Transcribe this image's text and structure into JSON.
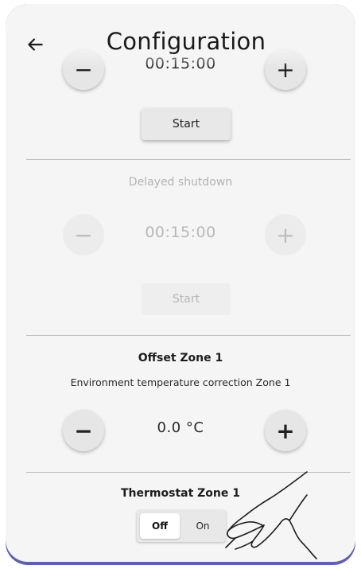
{
  "header": {
    "title": "Configuration",
    "back_icon": "arrow-left-icon"
  },
  "timer_section": {
    "time_value": "00:15:00",
    "minus_icon": "minus-icon",
    "plus_icon": "plus-icon",
    "start_label": "Start"
  },
  "delayed_shutdown": {
    "title": "Delayed shutdown",
    "time_value": "00:15:00",
    "minus_icon": "minus-icon",
    "plus_icon": "plus-icon",
    "start_label": "Start",
    "disabled": true
  },
  "offset_zone": {
    "title": "Offset Zone 1",
    "subtitle": "Environment temperature correction Zone 1",
    "value": "0.0 °C",
    "minus_icon": "minus-icon",
    "plus_icon": "plus-icon"
  },
  "thermostat_zone": {
    "title": "Thermostat Zone 1",
    "off_label": "Off",
    "on_label": "On",
    "selected": "Off"
  },
  "colors": {
    "frame_accent": "#5f5fb6",
    "background": "#f5f5f5"
  }
}
